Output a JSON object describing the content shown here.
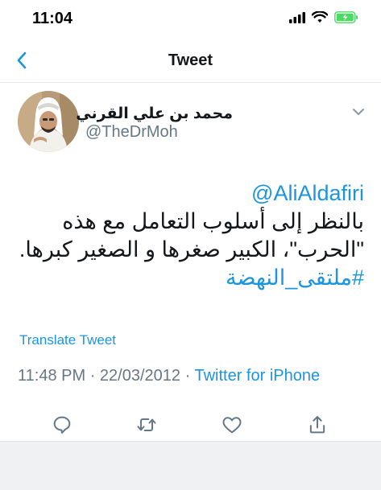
{
  "status_bar": {
    "time": "11:04"
  },
  "nav": {
    "title": "Tweet",
    "back_icon": "chevron-left-icon"
  },
  "tweet": {
    "display_name": "محمد بن علي القرني",
    "handle": "@TheDrMoh",
    "mention": "@AliAldafiri",
    "text_line_1": "بالنظر إلى أسلوب التعامل مع هذه",
    "text_line_2": "\"الحرب\"، الكبير صغرها و الصغير كبرها.",
    "hashtag": "#ملتقى_النهضة",
    "translate_label": "Translate Tweet",
    "time": "11:48 PM",
    "date": "22/03/2012",
    "separator": "·",
    "source": "Twitter for iPhone"
  },
  "actions": [
    "reply-icon",
    "retweet-icon",
    "like-icon",
    "share-icon"
  ],
  "colors": {
    "accent": "#1b95e0",
    "secondary_text": "#657786",
    "primary_text": "#14171a",
    "battery": "#4cd964"
  }
}
